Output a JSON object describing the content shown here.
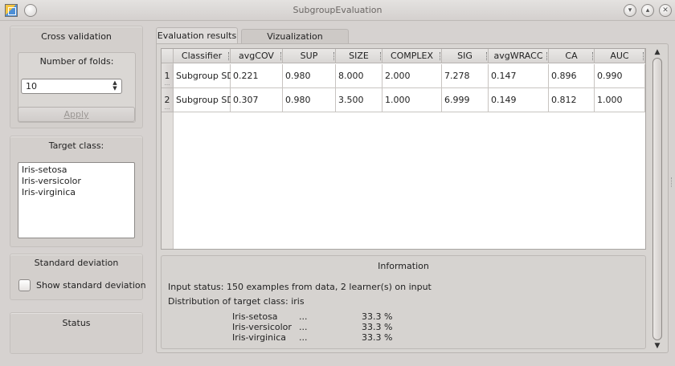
{
  "window": {
    "title": "SubgroupEvaluation"
  },
  "left_panel": {
    "cross_validation": {
      "title": "Cross validation",
      "folds_label": "Number of folds:",
      "folds_value": "10",
      "apply_label": "Apply"
    },
    "target_class": {
      "title": "Target class:",
      "items": [
        "Iris-setosa",
        "Iris-versicolor",
        "Iris-virginica"
      ]
    },
    "standard_deviation": {
      "title": "Standard deviation",
      "checkbox_label": "Show standard deviation",
      "checked": false
    },
    "status": {
      "title": "Status"
    }
  },
  "tabs": [
    {
      "label": "Evaluation results",
      "active": true
    },
    {
      "label": "Vizualization description",
      "active": false
    }
  ],
  "table": {
    "columns": [
      "Classifier",
      "avgCOV",
      "SUP",
      "SIZE",
      "COMPLEX",
      "SIG",
      "avgWRACC",
      "CA",
      "AUC"
    ],
    "rows": [
      {
        "index": "1",
        "cells": [
          "Subgroup SD",
          "0.221",
          "0.980",
          "8.000",
          "2.000",
          "7.278",
          "0.147",
          "0.896",
          "0.990"
        ]
      },
      {
        "index": "2",
        "cells": [
          "Subgroup SD",
          "0.307",
          "0.980",
          "3.500",
          "1.000",
          "6.999",
          "0.149",
          "0.812",
          "1.000"
        ]
      }
    ]
  },
  "information": {
    "title": "Information",
    "input_status": "Input status:  150 examples from data, 2 learner(s) on input",
    "distribution": "Distribution of target class:  iris",
    "classes": [
      {
        "name": "Iris-setosa",
        "dots": "...",
        "pct": "33.3 %"
      },
      {
        "name": "Iris-versicolor",
        "dots": "...",
        "pct": "33.3 %"
      },
      {
        "name": "Iris-virginica",
        "dots": "...",
        "pct": "33.3 %"
      }
    ]
  },
  "icons": {
    "app": "app-icon",
    "window_menu": "menu-circle-icon",
    "minimize": "minimize-icon",
    "maximize": "maximize-icon",
    "close": "close-icon"
  }
}
